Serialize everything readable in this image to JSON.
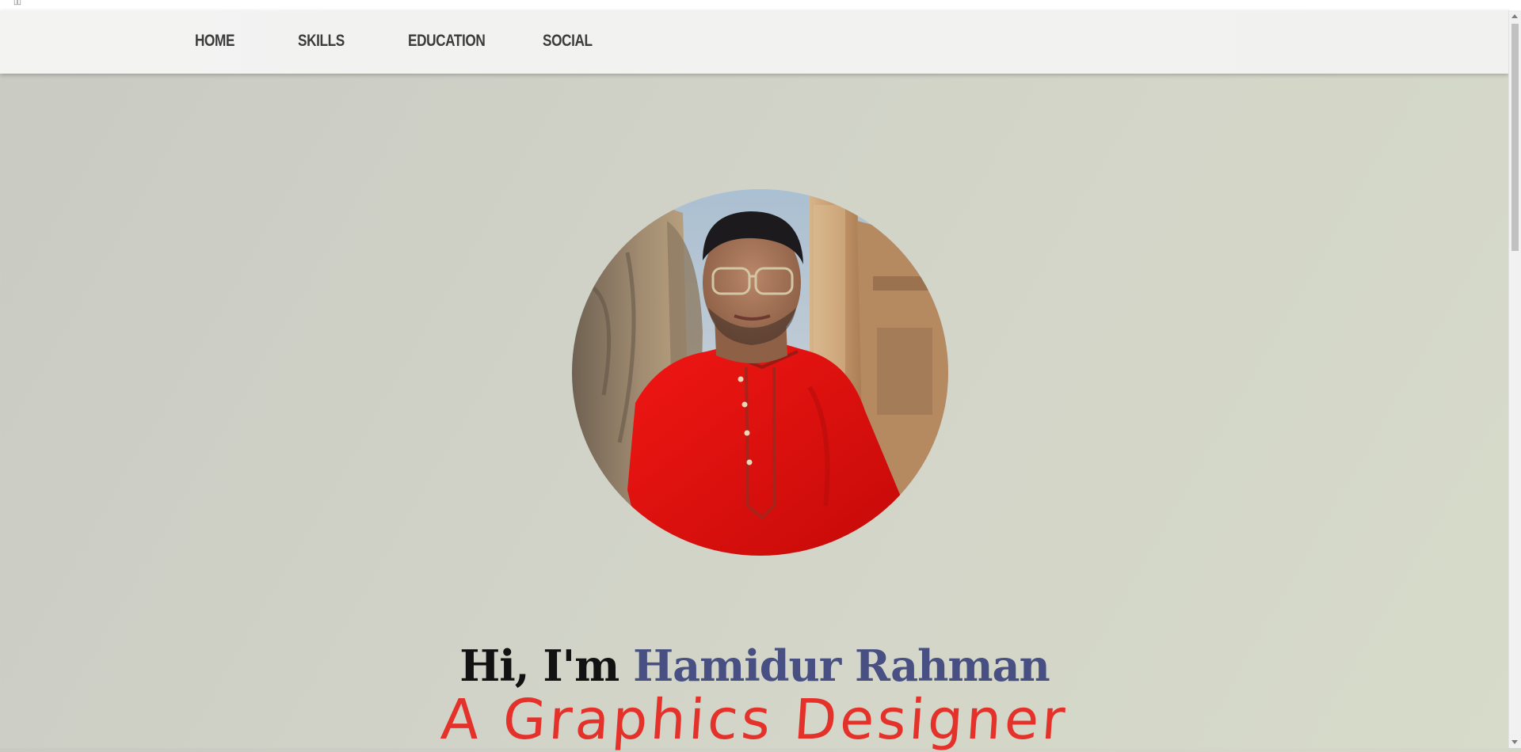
{
  "nav": {
    "items": [
      {
        "label": "HOME"
      },
      {
        "label": "SKILLS"
      },
      {
        "label": "EDUCATION"
      },
      {
        "label": "SOCIAL"
      }
    ]
  },
  "hero": {
    "greeting": "Hi, I'm",
    "name": "Hamidur Rahman",
    "role": "A Graphics Designer",
    "photo_icon": "profile-photo",
    "colors": {
      "name": "#474f83",
      "role": "#e4322b",
      "greeting": "#121212",
      "shirt": "#e50f0c"
    }
  }
}
